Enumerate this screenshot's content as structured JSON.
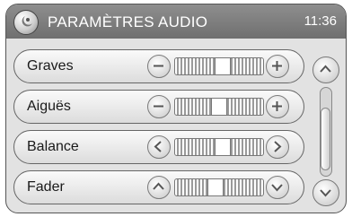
{
  "header": {
    "title": "PARAMÈTRES AUDIO",
    "time": "11:36"
  },
  "settings": [
    {
      "label": "Graves",
      "left_control": "minus-icon",
      "right_control": "plus-icon",
      "level": 0.55
    },
    {
      "label": "Aiguës",
      "left_control": "minus-icon",
      "right_control": "plus-icon",
      "level": 0.5
    },
    {
      "label": "Balance",
      "left_control": "chevron-left-icon",
      "right_control": "chevron-right-icon",
      "level": 0.55
    },
    {
      "label": "Fader",
      "left_control": "chevron-up-icon",
      "right_control": "chevron-down-icon",
      "level": 0.45
    }
  ],
  "scrollbar": {
    "up_icon": "chevron-up-icon",
    "down_icon": "chevron-down-icon"
  },
  "colors": {
    "titlebar": "#7d7d7d",
    "panel": "#e2e2e2",
    "text_on_title": "#ffffff"
  }
}
